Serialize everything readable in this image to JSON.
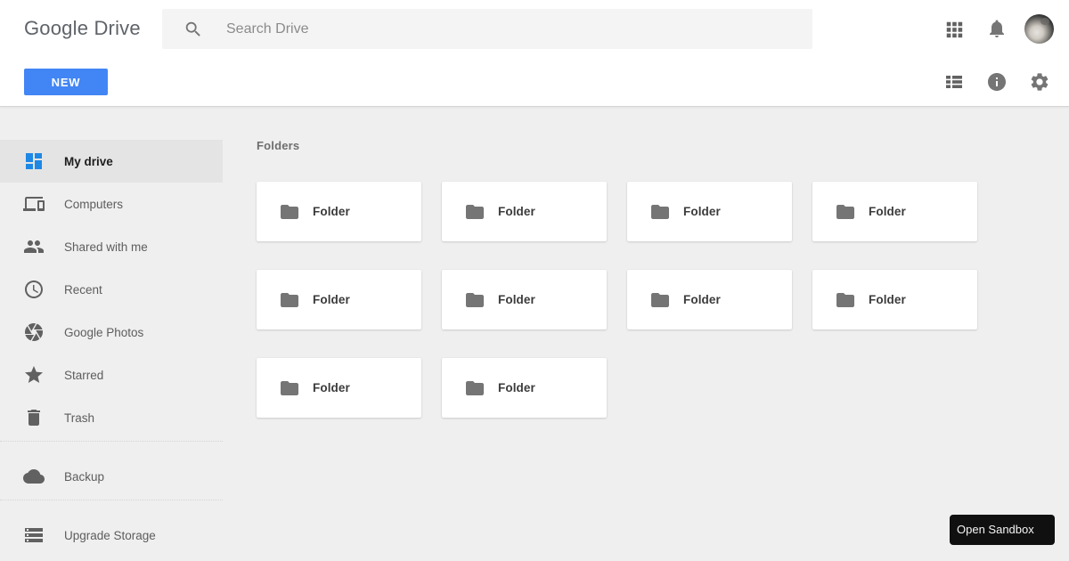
{
  "header": {
    "logo": "Google Drive",
    "search": {
      "placeholder": "Search Drive",
      "value": ""
    },
    "new_button_label": "NEW",
    "icons": [
      "apps-grid-icon",
      "notifications-bell-icon",
      "avatar",
      "view-list-icon",
      "info-icon",
      "settings-gear-icon",
      "search-icon"
    ]
  },
  "sidebar": {
    "items": [
      {
        "label": "My drive",
        "icon": "dashboard-icon",
        "active": true
      },
      {
        "label": "Computers",
        "icon": "devices-icon",
        "active": false
      },
      {
        "label": "Shared with me",
        "icon": "people-icon",
        "active": false
      },
      {
        "label": "Recent",
        "icon": "clock-icon",
        "active": false
      },
      {
        "label": "Google Photos",
        "icon": "camera-aperture-icon",
        "active": false
      },
      {
        "label": "Starred",
        "icon": "star-icon",
        "active": false
      },
      {
        "label": "Trash",
        "icon": "trash-icon",
        "active": false
      },
      {
        "label": "Backup",
        "icon": "cloud-icon",
        "active": false
      },
      {
        "label": "Upgrade Storage",
        "icon": "storage-icon",
        "active": false
      }
    ]
  },
  "main": {
    "section_label": "Folders",
    "folders": [
      {
        "name": "Folder"
      },
      {
        "name": "Folder"
      },
      {
        "name": "Folder"
      },
      {
        "name": "Folder"
      },
      {
        "name": "Folder"
      },
      {
        "name": "Folder"
      },
      {
        "name": "Folder"
      },
      {
        "name": "Folder"
      },
      {
        "name": "Folder"
      },
      {
        "name": "Folder"
      }
    ]
  },
  "sandbox_button": {
    "label": "Open Sandbox"
  },
  "colors": {
    "accent_blue": "#4285f4",
    "drive_icon_blue": "#1e88e5",
    "header_bg": "#ffffff",
    "content_bg": "#efefef",
    "active_item_bg": "#e4e4e4",
    "icon_gray": "#616161",
    "sandbox_bg": "#101010"
  }
}
